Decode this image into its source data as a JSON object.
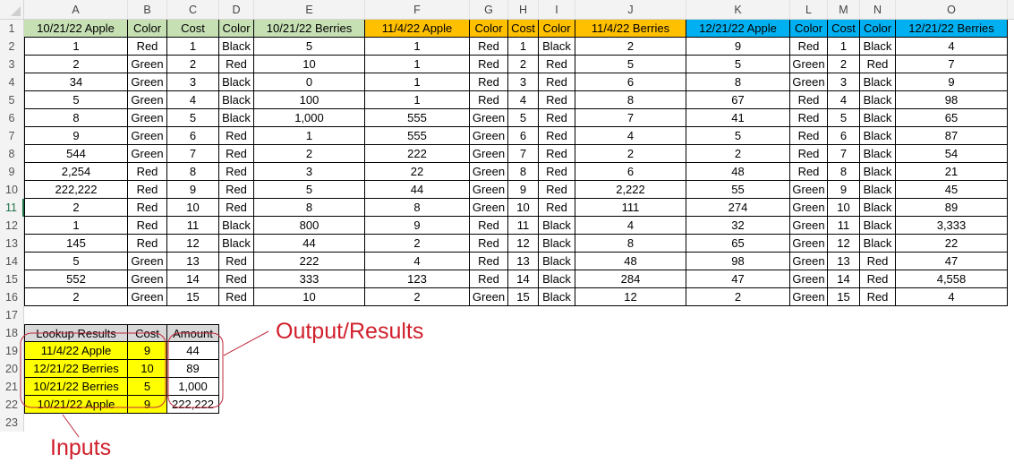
{
  "column_headers": [
    "A",
    "B",
    "C",
    "D",
    "E",
    "F",
    "G",
    "H",
    "I",
    "J",
    "K",
    "L",
    "M",
    "N",
    "O"
  ],
  "row_numbers": [
    "1",
    "2",
    "3",
    "4",
    "5",
    "6",
    "7",
    "8",
    "9",
    "10",
    "11",
    "12",
    "13",
    "14",
    "15",
    "16",
    "17",
    "18",
    "19",
    "20",
    "21",
    "22",
    "23"
  ],
  "selected_row": "11",
  "header_row": [
    "10/21/22 Apple",
    "Color",
    "Cost",
    "Color",
    "10/21/22 Berries",
    "11/4/22 Apple",
    "Color",
    "Cost",
    "Color",
    "11/4/22 Berries",
    "12/21/22 Apple",
    "Color",
    "Cost",
    "Color",
    "12/21/22 Berries"
  ],
  "header_colors": {
    "group1": "#c6e0b4",
    "group2": "#ffc000",
    "group3": "#00b0f0"
  },
  "rows": [
    [
      "1",
      "Red",
      "1",
      "Black",
      "5",
      "1",
      "Red",
      "1",
      "Black",
      "2",
      "9",
      "Red",
      "1",
      "Black",
      "4"
    ],
    [
      "2",
      "Green",
      "2",
      "Red",
      "10",
      "1",
      "Red",
      "2",
      "Red",
      "5",
      "5",
      "Green",
      "2",
      "Red",
      "7"
    ],
    [
      "34",
      "Green",
      "3",
      "Black",
      "0",
      "1",
      "Red",
      "3",
      "Red",
      "6",
      "8",
      "Green",
      "3",
      "Black",
      "9"
    ],
    [
      "5",
      "Green",
      "4",
      "Black",
      "100",
      "1",
      "Red",
      "4",
      "Red",
      "8",
      "67",
      "Red",
      "4",
      "Black",
      "98"
    ],
    [
      "8",
      "Green",
      "5",
      "Black",
      "1,000",
      "555",
      "Green",
      "5",
      "Red",
      "7",
      "41",
      "Red",
      "5",
      "Black",
      "65"
    ],
    [
      "9",
      "Green",
      "6",
      "Red",
      "1",
      "555",
      "Green",
      "6",
      "Red",
      "4",
      "5",
      "Red",
      "6",
      "Black",
      "87"
    ],
    [
      "544",
      "Green",
      "7",
      "Red",
      "2",
      "222",
      "Green",
      "7",
      "Red",
      "2",
      "2",
      "Red",
      "7",
      "Black",
      "54"
    ],
    [
      "2,254",
      "Red",
      "8",
      "Red",
      "3",
      "22",
      "Green",
      "8",
      "Red",
      "6",
      "48",
      "Red",
      "8",
      "Black",
      "21"
    ],
    [
      "222,222",
      "Red",
      "9",
      "Red",
      "5",
      "44",
      "Green",
      "9",
      "Red",
      "2,222",
      "55",
      "Green",
      "9",
      "Black",
      "45"
    ],
    [
      "2",
      "Red",
      "10",
      "Red",
      "8",
      "8",
      "Green",
      "10",
      "Red",
      "111",
      "274",
      "Green",
      "10",
      "Black",
      "89"
    ],
    [
      "1",
      "Red",
      "11",
      "Black",
      "800",
      "9",
      "Red",
      "11",
      "Black",
      "4",
      "32",
      "Green",
      "11",
      "Black",
      "3,333"
    ],
    [
      "145",
      "Red",
      "12",
      "Black",
      "44",
      "2",
      "Red",
      "12",
      "Black",
      "8",
      "65",
      "Green",
      "12",
      "Black",
      "22"
    ],
    [
      "5",
      "Green",
      "13",
      "Red",
      "222",
      "4",
      "Red",
      "13",
      "Black",
      "48",
      "98",
      "Green",
      "13",
      "Red",
      "47"
    ],
    [
      "552",
      "Green",
      "14",
      "Red",
      "333",
      "123",
      "Red",
      "14",
      "Black",
      "284",
      "47",
      "Green",
      "14",
      "Red",
      "4,558"
    ],
    [
      "2",
      "Green",
      "15",
      "Red",
      "10",
      "2",
      "Green",
      "15",
      "Black",
      "12",
      "2",
      "Green",
      "15",
      "Red",
      "4"
    ]
  ],
  "lookup": {
    "headers": [
      "Lookup Results",
      "Cost",
      "Amount"
    ],
    "rows": [
      {
        "item": "11/4/22 Apple",
        "cost": "9",
        "amount": "44"
      },
      {
        "item": "12/21/22 Berries",
        "cost": "10",
        "amount": "89"
      },
      {
        "item": "10/21/22 Berries",
        "cost": "5",
        "amount": "1,000"
      },
      {
        "item": "10/21/22 Apple",
        "cost": "9",
        "amount": "222,222"
      }
    ]
  },
  "annotations": {
    "output": "Output/Results",
    "inputs": "Inputs",
    "color": "#d0202c"
  }
}
